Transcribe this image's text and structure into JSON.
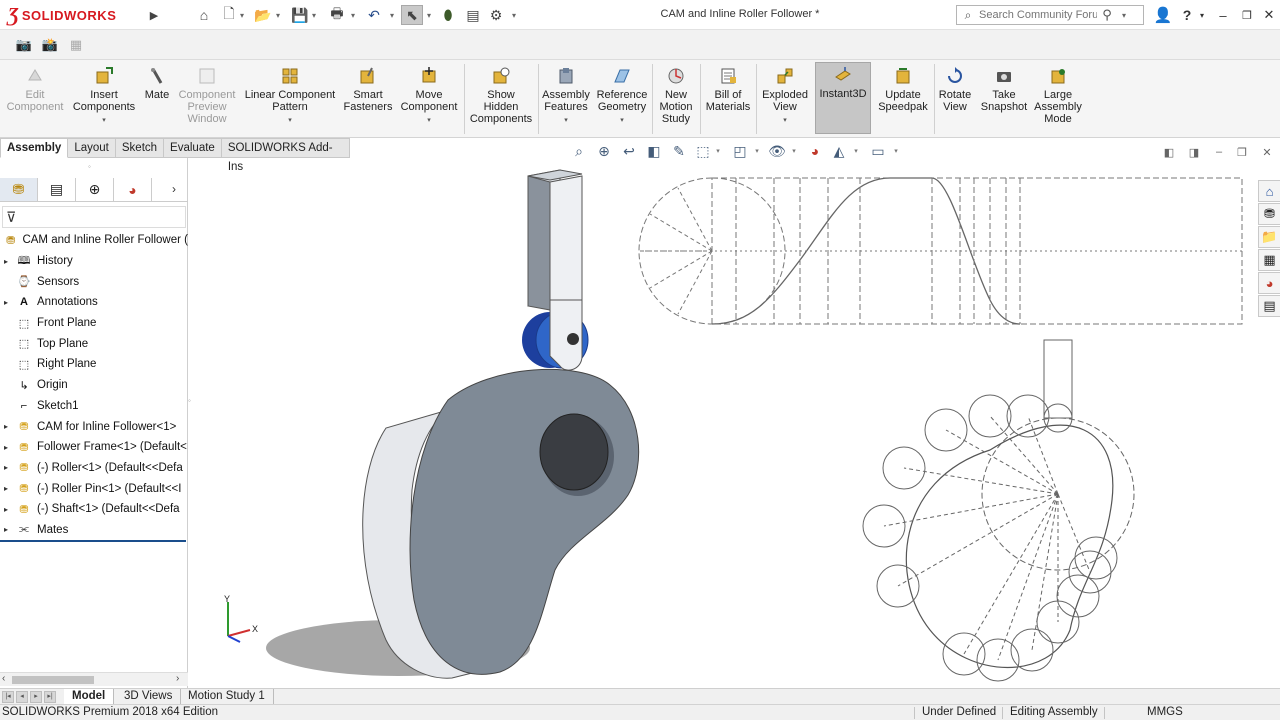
{
  "app": {
    "logo_brand": "SOLIDWORKS",
    "document_title": "CAM and Inline Roller Follower *",
    "search_placeholder": "Search Community Forum"
  },
  "colors": {
    "brand_red": "#d71920",
    "selection_blue": "#1a4e8c",
    "cam_gray": "#7f8a96",
    "roller_blue": "#2f66c8"
  },
  "quick_access_icons": [
    "home-icon",
    "new-document-icon",
    "open-icon",
    "save-icon",
    "print-icon",
    "undo-icon",
    "select-icon",
    "rebuild-icon",
    "file-properties-icon",
    "options-icon"
  ],
  "ribbon": {
    "commands": [
      {
        "label": "Edit\nComponent",
        "enabled": false
      },
      {
        "label": "Insert\nComponents"
      },
      {
        "label": "Mate"
      },
      {
        "label": "Component\nPreview\nWindow",
        "enabled": false
      },
      {
        "label": "Linear Component\nPattern"
      },
      {
        "label": "Smart\nFasteners"
      },
      {
        "label": "Move\nComponent"
      },
      {
        "label": "Show\nHidden\nComponents"
      },
      {
        "label": "Assembly\nFeatures"
      },
      {
        "label": "Reference\nGeometry"
      },
      {
        "label": "New\nMotion\nStudy"
      },
      {
        "label": "Bill of\nMaterials"
      },
      {
        "label": "Exploded\nView"
      },
      {
        "label": "Instant3D",
        "active": true
      },
      {
        "label": "Update\nSpeedpak"
      },
      {
        "label": "Rotate\nView"
      },
      {
        "label": "Take\nSnapshot"
      },
      {
        "label": "Large\nAssembly\nMode"
      }
    ]
  },
  "tabs": [
    {
      "label": "Assembly",
      "active": true
    },
    {
      "label": "Layout"
    },
    {
      "label": "Sketch"
    },
    {
      "label": "Evaluate"
    },
    {
      "label": "SOLIDWORKS Add-Ins"
    }
  ],
  "feature_tree": {
    "root": "CAM and Inline Roller Follower  (",
    "items": [
      {
        "label": "History"
      },
      {
        "label": "Sensors"
      },
      {
        "label": "Annotations"
      },
      {
        "label": "Front Plane"
      },
      {
        "label": "Top Plane"
      },
      {
        "label": "Right Plane"
      },
      {
        "label": "Origin"
      },
      {
        "label": "Sketch1"
      },
      {
        "label": "CAM for Inline Follower<1>"
      },
      {
        "label": "Follower Frame<1> (Default<"
      },
      {
        "label": "(-) Roller<1> (Default<<Defa"
      },
      {
        "label": "(-) Roller Pin<1> (Default<<I"
      },
      {
        "label": "(-) Shaft<1> (Default<<Defa"
      },
      {
        "label": "Mates"
      }
    ]
  },
  "triad": {
    "x": "X",
    "y": "Y"
  },
  "bottom_tabs": [
    {
      "label": "Model",
      "active": true
    },
    {
      "label": "3D Views"
    },
    {
      "label": "Motion Study 1"
    }
  ],
  "status": {
    "edition": "SOLIDWORKS Premium 2018 x64 Edition",
    "state": "Under Defined",
    "mode": "Editing Assembly",
    "units": "MMGS"
  }
}
